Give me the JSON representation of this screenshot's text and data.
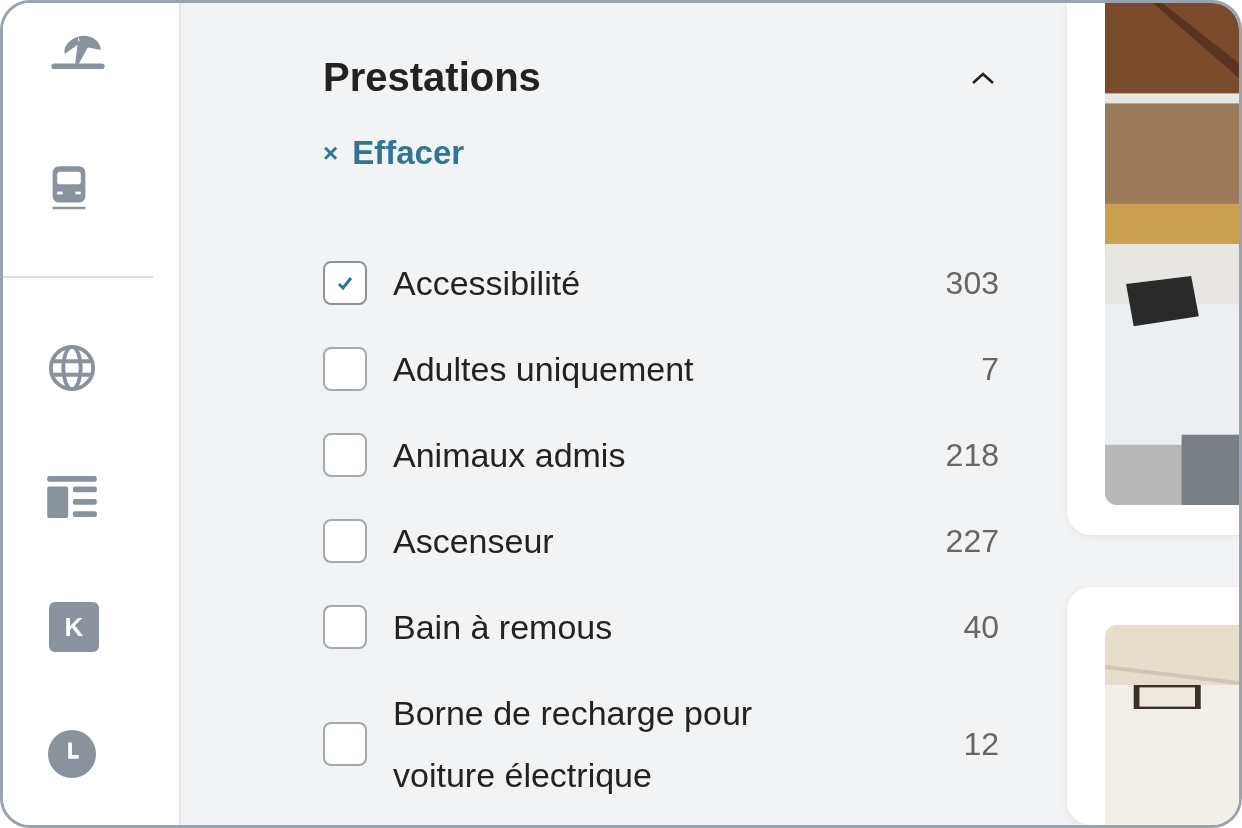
{
  "rail": {
    "logo_letter": "K"
  },
  "filter": {
    "title": "Prestations",
    "expanded": true,
    "clear_label": "Effacer",
    "clear_icon": "×",
    "options": [
      {
        "label": "Accessibilité",
        "count": "303",
        "checked": true
      },
      {
        "label": "Adultes uniquement",
        "count": "7",
        "checked": false
      },
      {
        "label": "Animaux admis",
        "count": "218",
        "checked": false
      },
      {
        "label": "Ascenseur",
        "count": "227",
        "checked": false
      },
      {
        "label": "Bain à remous",
        "count": "40",
        "checked": false
      },
      {
        "label": "Borne de recharge pour voiture électrique",
        "count": "12",
        "checked": false
      }
    ]
  }
}
